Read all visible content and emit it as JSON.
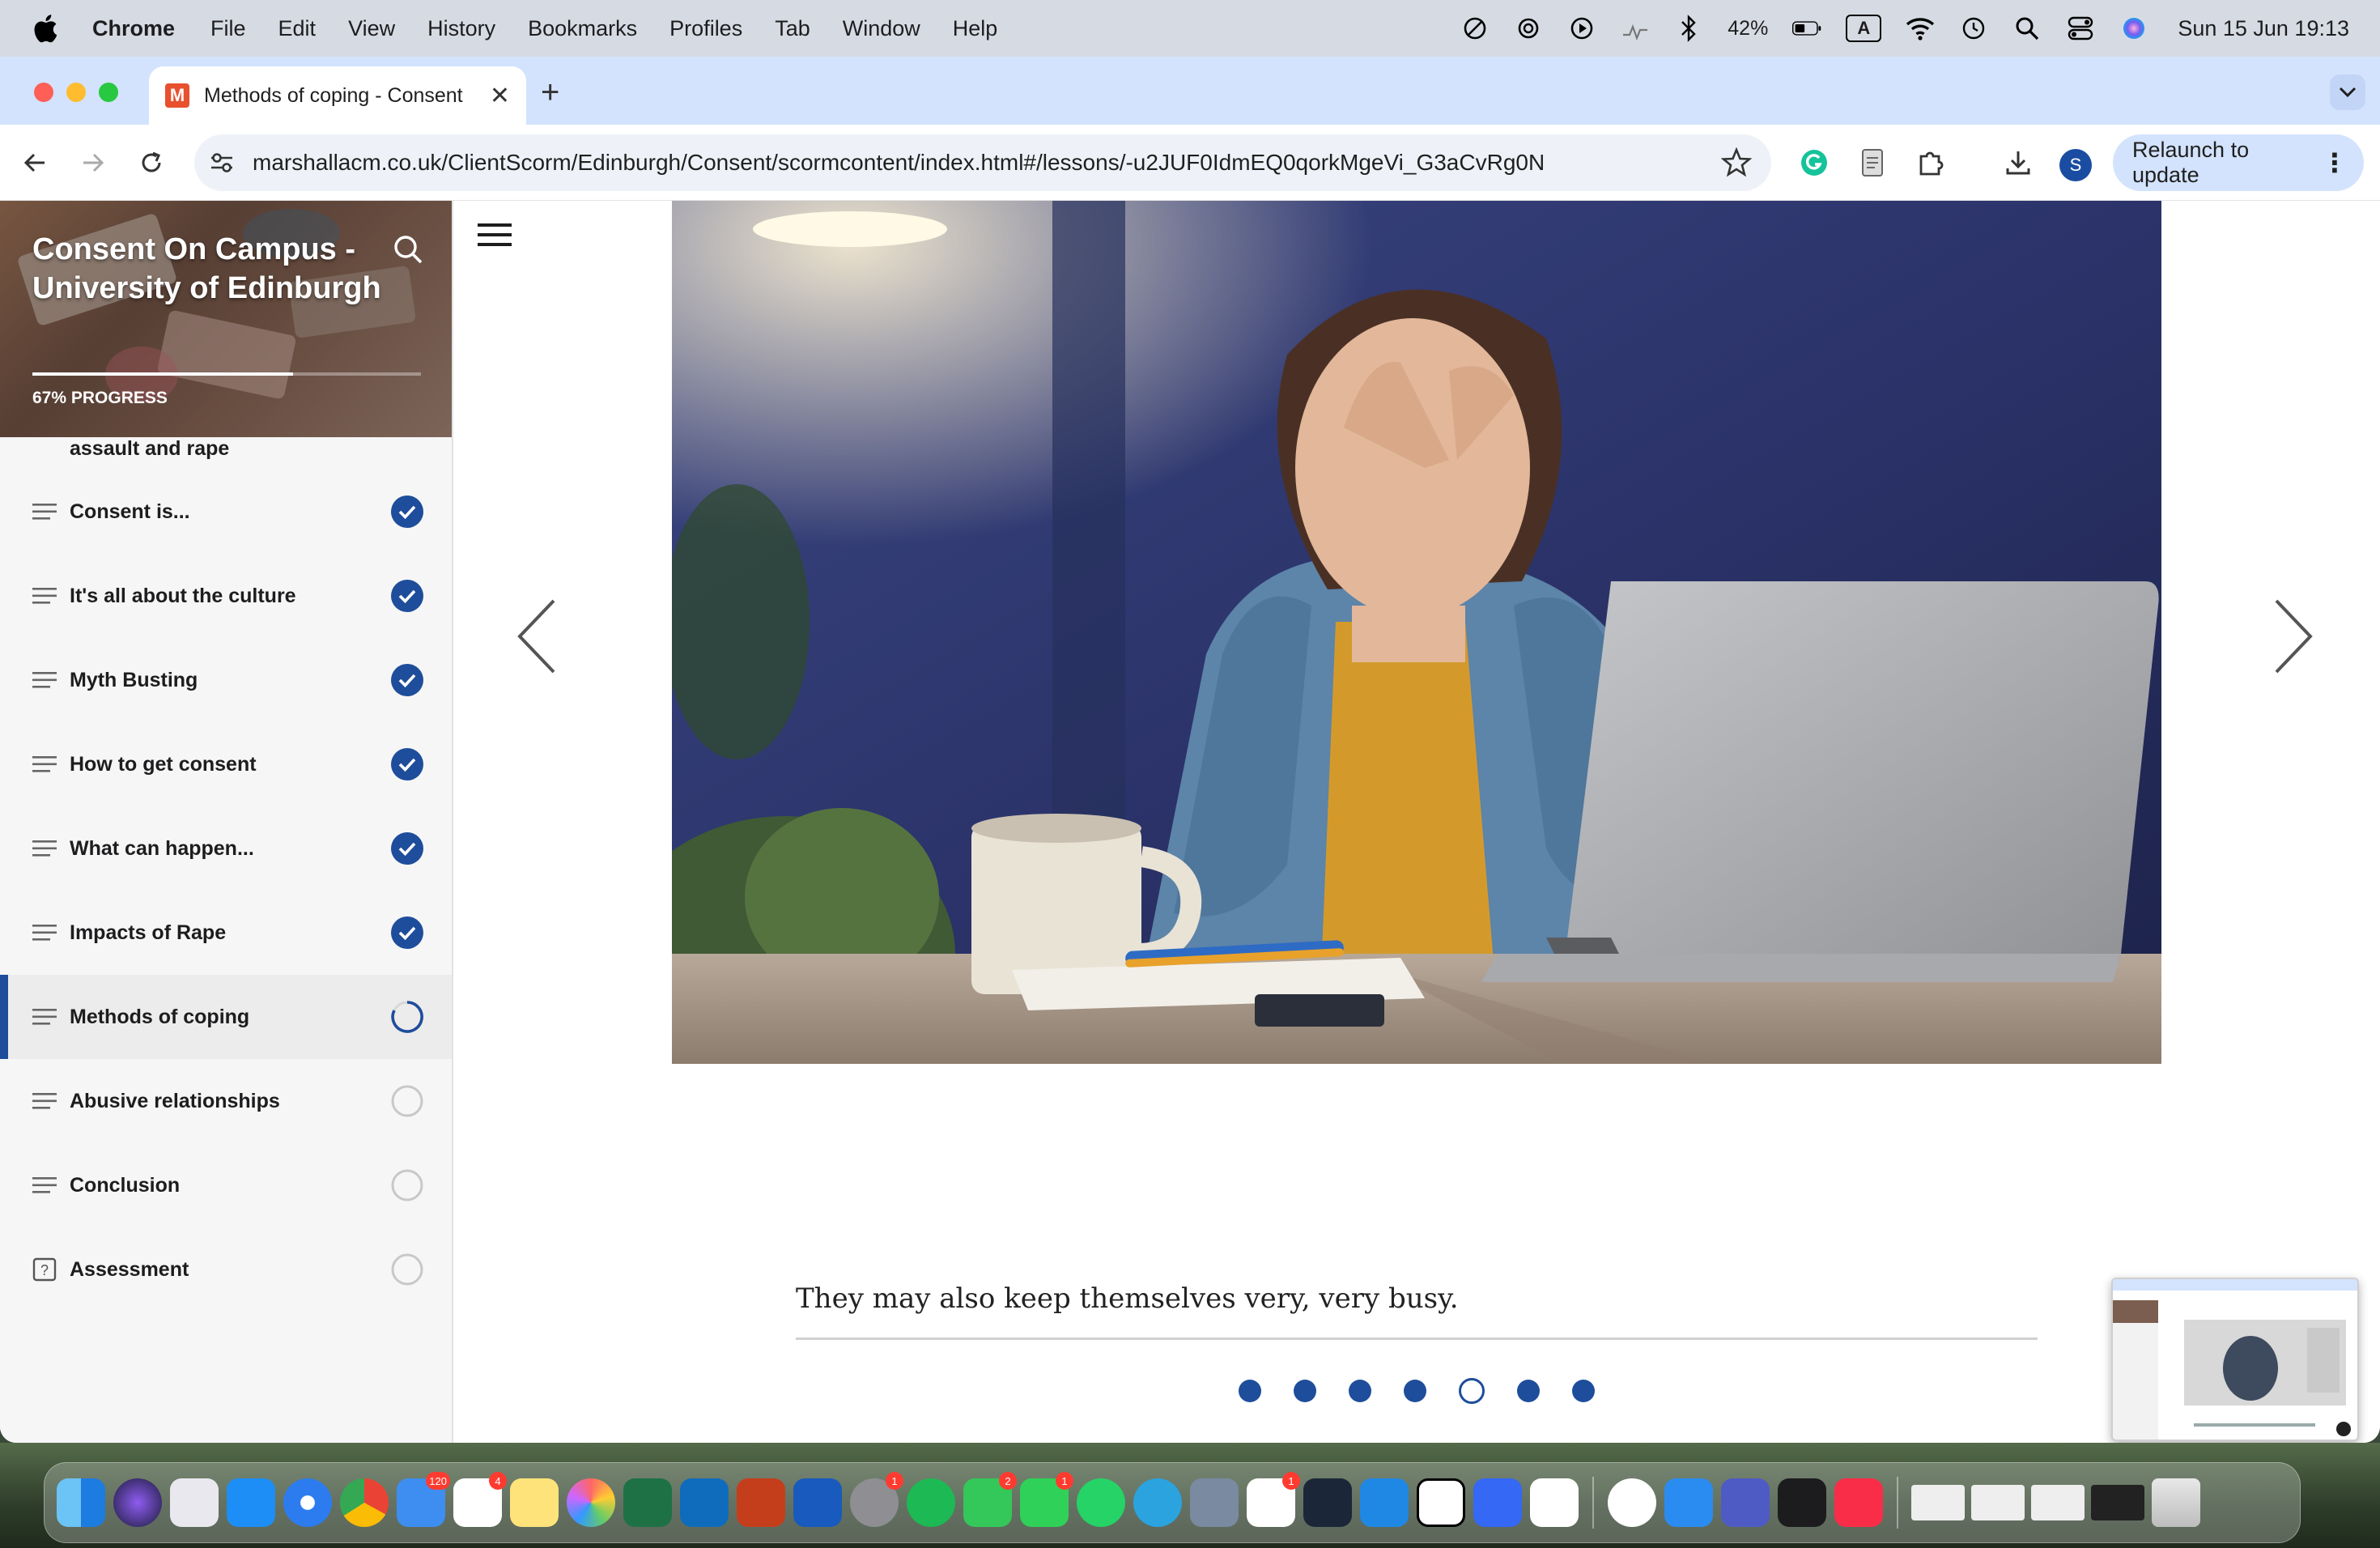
{
  "menubar": {
    "app_name": "Chrome",
    "items": [
      "File",
      "Edit",
      "View",
      "History",
      "Bookmarks",
      "Profiles",
      "Tab",
      "Window",
      "Help"
    ],
    "battery_percent": "42%",
    "input_source": "A",
    "clock": "Sun 15 Jun  19:13"
  },
  "browser": {
    "tab_title": "Methods of coping - Consent",
    "favicon_letter": "M",
    "url": "marshallacm.co.uk/ClientScorm/Edinburgh/Consent/scormcontent/index.html#/lessons/-u2JUF0IdmEQ0qorkMgeVi_G3aCvRg0N",
    "profile_initial": "S",
    "relaunch_label": "Relaunch to update"
  },
  "course": {
    "title": "Consent On Campus - University of Edinburgh",
    "progress_label": "67% PROGRESS",
    "progress_fraction": 0.67,
    "partial_lesson": "assault and rape",
    "lessons": [
      {
        "label": "Consent is...",
        "status": "complete",
        "icon": "hamburger-icon"
      },
      {
        "label": "It's all about the culture",
        "status": "complete",
        "icon": "hamburger-icon"
      },
      {
        "label": "Myth Busting",
        "status": "complete",
        "icon": "hamburger-icon"
      },
      {
        "label": "How to get consent",
        "status": "complete",
        "icon": "hamburger-icon"
      },
      {
        "label": "What can happen...",
        "status": "complete",
        "icon": "hamburger-icon"
      },
      {
        "label": "Impacts of Rape",
        "status": "complete",
        "icon": "hamburger-icon"
      },
      {
        "label": "Methods of coping",
        "status": "in-progress",
        "icon": "hamburger-icon"
      },
      {
        "label": "Abusive relationships",
        "status": "not-started",
        "icon": "hamburger-icon"
      },
      {
        "label": "Conclusion",
        "status": "not-started",
        "icon": "hamburger-icon"
      },
      {
        "label": "Assessment",
        "status": "not-started",
        "icon": "quiz-icon"
      }
    ]
  },
  "slide": {
    "caption": "They may also keep themselves very, very busy.",
    "total_slides": 7,
    "current_slide": 5
  },
  "colors": {
    "accent": "#1e4d9b",
    "tabstrip": "#d3e3fd",
    "sidebar_bg": "#f6f6f6"
  }
}
